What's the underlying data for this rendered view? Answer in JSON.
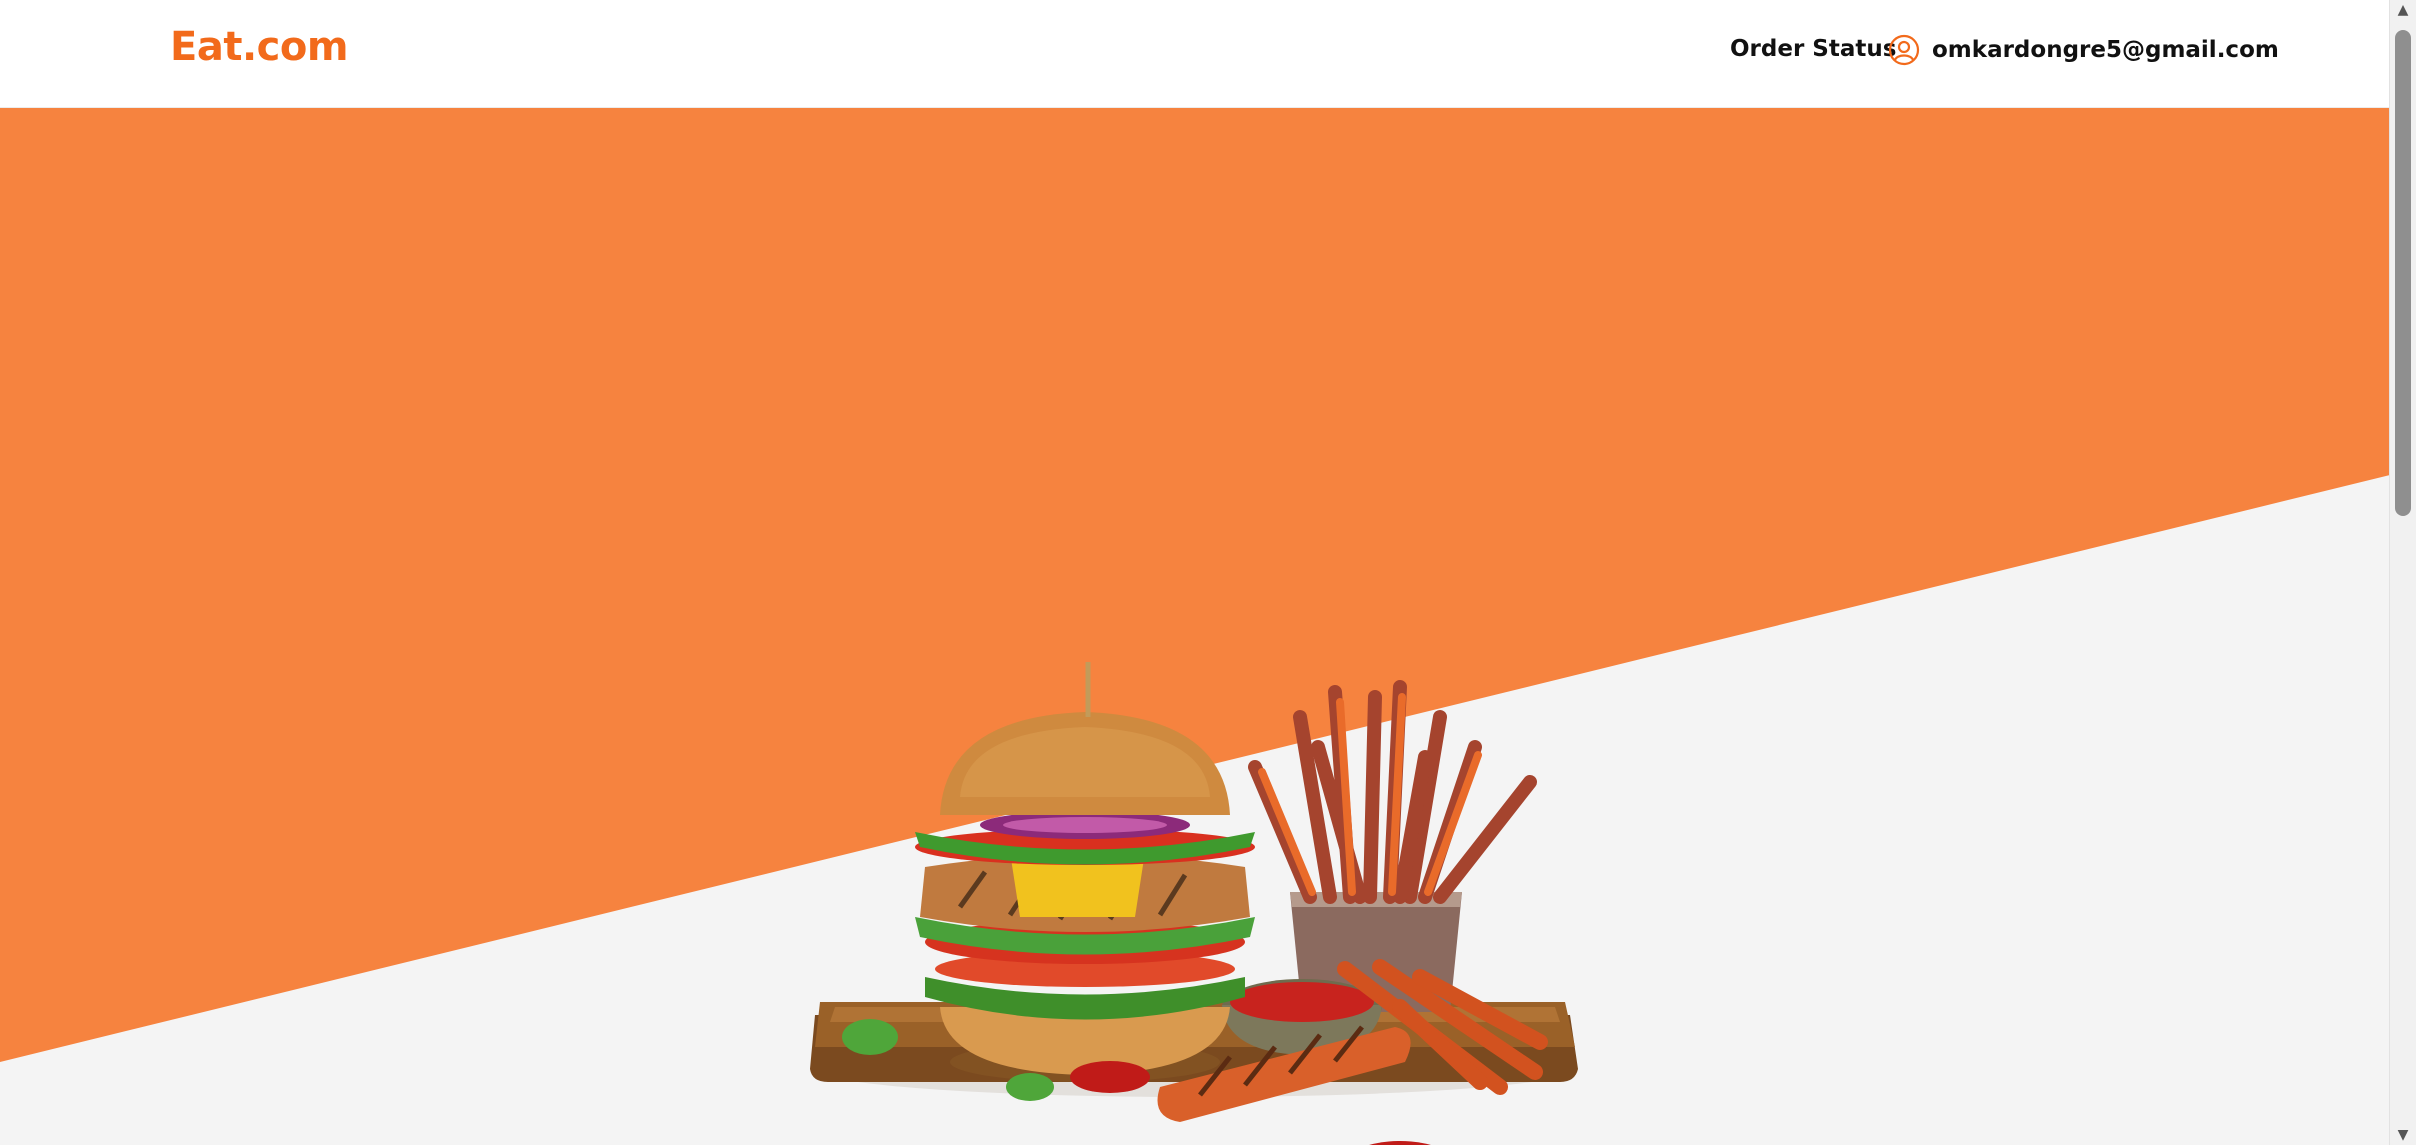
{
  "header": {
    "logo": "Eat.com",
    "order_status": "Order Status",
    "user_email": "omkardongre5@gmail.com"
  },
  "icons": {
    "user": "user-circle-icon",
    "scroll_up": "arrow-up-icon",
    "scroll_down": "arrow-down-icon"
  },
  "hero": {
    "image": "burger-and-fries-illustration"
  },
  "colors": {
    "brand": "#f26a1b",
    "hero_orange": "#f6833f",
    "hero_light": "#f4f4f4"
  }
}
